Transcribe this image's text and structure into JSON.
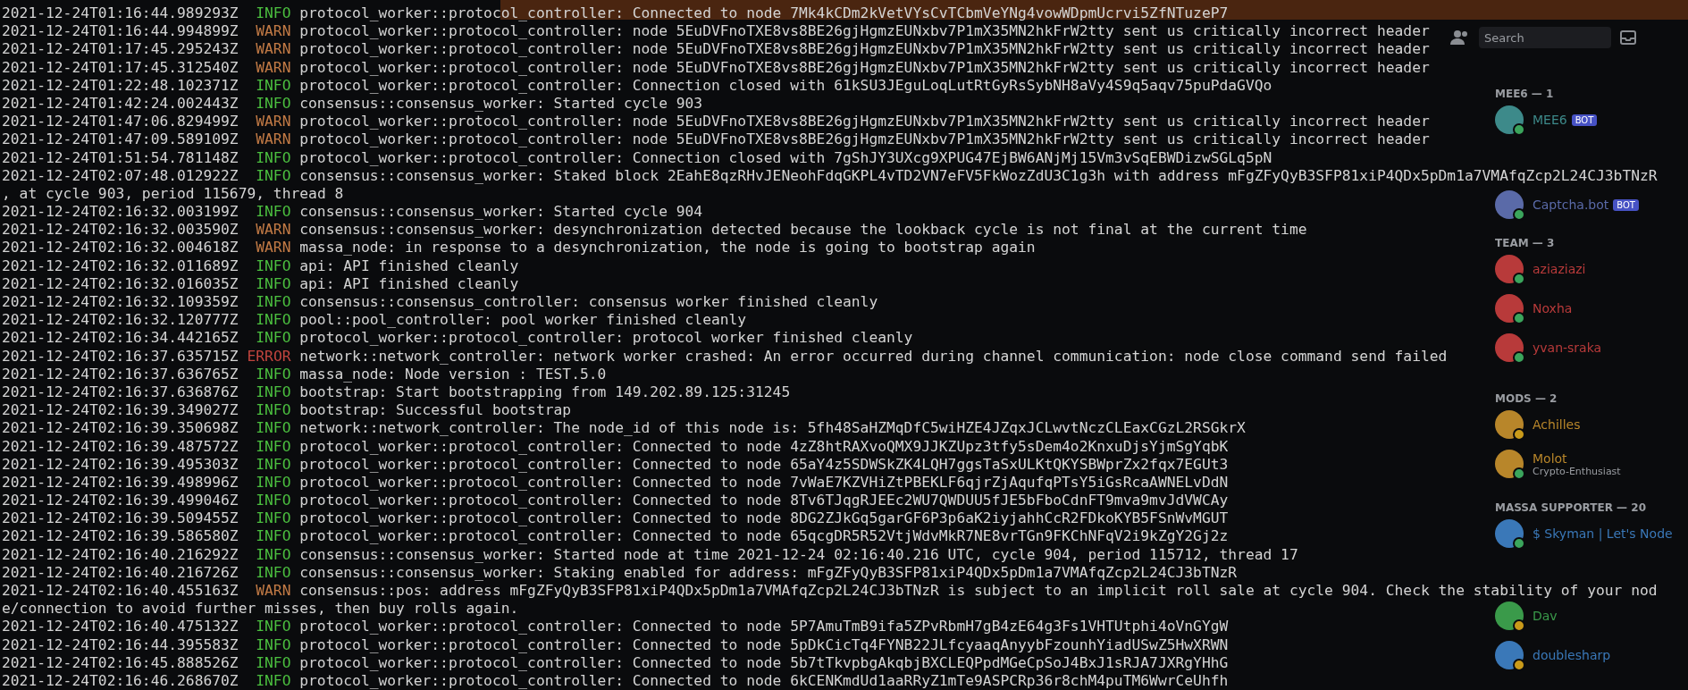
{
  "discord": {
    "search": {
      "placeholder": "Search"
    },
    "member_groups": [
      {
        "heading": "MEE6 — 1",
        "members": [
          {
            "name": "MEE6",
            "tag": "BOT",
            "color": "#3d8a8a",
            "idle": false
          }
        ]
      },
      {
        "members": [
          {
            "name": "Captcha.bot",
            "tag": "BOT",
            "color": "#5a6aa8",
            "idle": false
          }
        ]
      },
      {
        "heading": "TEAM — 3",
        "members": [
          {
            "name": "aziaziazi",
            "color": "#b83a3a",
            "idle": false
          },
          {
            "name": "Noxha",
            "color": "#b83a3a",
            "idle": false
          },
          {
            "name": "yvan-sraka",
            "color": "#b83a3a",
            "idle": false
          }
        ]
      },
      {
        "heading": "MODS — 2",
        "members": [
          {
            "name": "Achilles",
            "color": "#b8862a",
            "idle": true
          },
          {
            "name": "Molot",
            "subtitle": "Crypto-Enthusiast",
            "color": "#b8862a",
            "idle": false
          }
        ]
      },
      {
        "heading": "MASSA SUPPORTER — 20",
        "members": [
          {
            "name": "$ Skyman | Let's Node",
            "color": "#3a78b8",
            "idle": false
          },
          {
            "name": "Dav",
            "color": "#3a9a4a",
            "idle": true
          },
          {
            "name": "doublesharp",
            "color": "#3a78b8",
            "idle": true
          }
        ]
      }
    ]
  },
  "terminal": {
    "lines": [
      {
        "kind": "log",
        "timestamp": "2021-12-24T01:16:44.989293Z",
        "level": "INFO",
        "message": "protocol_worker::protocol_controller: Connected to node 7Mk4kCDm2kVetVYsCvTCbmVeYNg4vowWDpmUcrvi5ZfNTuzeP7"
      },
      {
        "kind": "log",
        "timestamp": "2021-12-24T01:16:44.994899Z",
        "level": "WARN",
        "message": "protocol_worker::protocol_controller: node 5EuDVFnoTXE8vs8BE26gjHgmzEUNxbv7P1mX35MN2hkFrW2tty sent us critically incorrect header"
      },
      {
        "kind": "log",
        "timestamp": "2021-12-24T01:17:45.295243Z",
        "level": "WARN",
        "message": "protocol_worker::protocol_controller: node 5EuDVFnoTXE8vs8BE26gjHgmzEUNxbv7P1mX35MN2hkFrW2tty sent us critically incorrect header"
      },
      {
        "kind": "log",
        "timestamp": "2021-12-24T01:17:45.312540Z",
        "level": "WARN",
        "message": "protocol_worker::protocol_controller: node 5EuDVFnoTXE8vs8BE26gjHgmzEUNxbv7P1mX35MN2hkFrW2tty sent us critically incorrect header"
      },
      {
        "kind": "log",
        "timestamp": "2021-12-24T01:22:48.102371Z",
        "level": "INFO",
        "message": "protocol_worker::protocol_controller: Connection closed with 61kSU3JEguLoqLutRtGyRsSybNH8aVy4S9q5aqv75puPdaGVQo"
      },
      {
        "kind": "log",
        "timestamp": "2021-12-24T01:42:24.002443Z",
        "level": "INFO",
        "message": "consensus::consensus_worker: Started cycle 903"
      },
      {
        "kind": "log",
        "timestamp": "2021-12-24T01:47:06.829499Z",
        "level": "WARN",
        "message": "protocol_worker::protocol_controller: node 5EuDVFnoTXE8vs8BE26gjHgmzEUNxbv7P1mX35MN2hkFrW2tty sent us critically incorrect header"
      },
      {
        "kind": "log",
        "timestamp": "2021-12-24T01:47:09.589109Z",
        "level": "WARN",
        "message": "protocol_worker::protocol_controller: node 5EuDVFnoTXE8vs8BE26gjHgmzEUNxbv7P1mX35MN2hkFrW2tty sent us critically incorrect header"
      },
      {
        "kind": "log",
        "timestamp": "2021-12-24T01:51:54.781148Z",
        "level": "INFO",
        "message": "protocol_worker::protocol_controller: Connection closed with 7gShJY3UXcg9XPUG47EjBW6ANjMj15Vm3vSqEBWDizwSGLq5pN"
      },
      {
        "kind": "log",
        "timestamp": "2021-12-24T02:07:48.012922Z",
        "level": "INFO",
        "message": "consensus::consensus_worker: Staked block 2EahE8qzRHvJENeohFdqGKPL4vTD2VN7eFV5FkWozZdU3C1g3h with address mFgZFyQyB3SFP81xiP4QDx5pDm1a7VMAfqZcp2L24CJ3bTNzR"
      },
      {
        "kind": "wrap",
        "message": ", at cycle 903, period 115679, thread 8"
      },
      {
        "kind": "log",
        "timestamp": "2021-12-24T02:16:32.003199Z",
        "level": "INFO",
        "message": "consensus::consensus_worker: Started cycle 904"
      },
      {
        "kind": "log",
        "timestamp": "2021-12-24T02:16:32.003590Z",
        "level": "WARN",
        "message": "consensus::consensus_worker: desynchronization detected because the lookback cycle is not final at the current time"
      },
      {
        "kind": "log",
        "timestamp": "2021-12-24T02:16:32.004618Z",
        "level": "WARN",
        "message": "massa_node: in response to a desynchronization, the node is going to bootstrap again"
      },
      {
        "kind": "log",
        "timestamp": "2021-12-24T02:16:32.011689Z",
        "level": "INFO",
        "message": "api: API finished cleanly"
      },
      {
        "kind": "log",
        "timestamp": "2021-12-24T02:16:32.016035Z",
        "level": "INFO",
        "message": "api: API finished cleanly"
      },
      {
        "kind": "log",
        "timestamp": "2021-12-24T02:16:32.109359Z",
        "level": "INFO",
        "message": "consensus::consensus_controller: consensus worker finished cleanly"
      },
      {
        "kind": "log",
        "timestamp": "2021-12-24T02:16:32.120777Z",
        "level": "INFO",
        "message": "pool::pool_controller: pool worker finished cleanly"
      },
      {
        "kind": "log",
        "timestamp": "2021-12-24T02:16:34.442165Z",
        "level": "INFO",
        "message": "protocol_worker::protocol_controller: protocol worker finished cleanly"
      },
      {
        "kind": "log",
        "timestamp": "2021-12-24T02:16:37.635715Z",
        "level": "ERROR",
        "message": "network::network_controller: network worker crashed: An error occurred during channel communication: node close command send failed"
      },
      {
        "kind": "log",
        "timestamp": "2021-12-24T02:16:37.636765Z",
        "level": "INFO",
        "message": "massa_node: Node version : TEST.5.0"
      },
      {
        "kind": "log",
        "timestamp": "2021-12-24T02:16:37.636876Z",
        "level": "INFO",
        "message": "bootstrap: Start bootstrapping from 149.202.89.125:31245"
      },
      {
        "kind": "log",
        "timestamp": "2021-12-24T02:16:39.349027Z",
        "level": "INFO",
        "message": "bootstrap: Successful bootstrap"
      },
      {
        "kind": "log",
        "timestamp": "2021-12-24T02:16:39.350698Z",
        "level": "INFO",
        "message": "network::network_controller: The node_id of this node is: 5fh48SaHZMqDfC5wiHZE4JZqxJCLwvtNczCLEaxCGzL2RSGkrX"
      },
      {
        "kind": "log",
        "timestamp": "2021-12-24T02:16:39.487572Z",
        "level": "INFO",
        "message": "protocol_worker::protocol_controller: Connected to node 4zZ8htRAXvoQMX9JJKZUpz3tfy5sDem4o2KnxuDjsYjmSgYqbK"
      },
      {
        "kind": "log",
        "timestamp": "2021-12-24T02:16:39.495303Z",
        "level": "INFO",
        "message": "protocol_worker::protocol_controller: Connected to node 65aY4z5SDWSkZK4LQH7ggsTaSxULKtQKYSBWprZx2fqx7EGUt3"
      },
      {
        "kind": "log",
        "timestamp": "2021-12-24T02:16:39.498996Z",
        "level": "INFO",
        "message": "protocol_worker::protocol_controller: Connected to node 7vWaE7KZVHiZtPBEKLF6qjrZjAqufqPTsY5iGsRcaAWNELvDdN"
      },
      {
        "kind": "log",
        "timestamp": "2021-12-24T02:16:39.499046Z",
        "level": "INFO",
        "message": "protocol_worker::protocol_controller: Connected to node 8Tv6TJqgRJEEc2WU7QWDUU5fJE5bFboCdnFT9mva9mvJdVWCAy"
      },
      {
        "kind": "log",
        "timestamp": "2021-12-24T02:16:39.509455Z",
        "level": "INFO",
        "message": "protocol_worker::protocol_controller: Connected to node 8DG2ZJkGq5garGF6P3p6aK2iyjahhCcR2FDkoKYB5FSnWvMGUT"
      },
      {
        "kind": "log",
        "timestamp": "2021-12-24T02:16:39.586580Z",
        "level": "INFO",
        "message": "protocol_worker::protocol_controller: Connected to node 65qcgDR5R52VtjWdvMkR7NE8vrTGn9FKChNFqV2i9kZgY2Gj2z"
      },
      {
        "kind": "log",
        "timestamp": "2021-12-24T02:16:40.216292Z",
        "level": "INFO",
        "message": "consensus::consensus_worker: Started node at time 2021-12-24 02:16:40.216 UTC, cycle 904, period 115712, thread 17"
      },
      {
        "kind": "log",
        "timestamp": "2021-12-24T02:16:40.216726Z",
        "level": "INFO",
        "message": "consensus::consensus_worker: Staking enabled for address: mFgZFyQyB3SFP81xiP4QDx5pDm1a7VMAfqZcp2L24CJ3bTNzR"
      },
      {
        "kind": "log",
        "timestamp": "2021-12-24T02:16:40.455163Z",
        "level": "WARN",
        "message": "consensus::pos: address mFgZFyQyB3SFP81xiP4QDx5pDm1a7VMAfqZcp2L24CJ3bTNzR is subject to an implicit roll sale at cycle 904. Check the stability of your nod"
      },
      {
        "kind": "wrap",
        "message": "e/connection to avoid further misses, then buy rolls again."
      },
      {
        "kind": "log",
        "timestamp": "2021-12-24T02:16:40.475132Z",
        "level": "INFO",
        "message": "protocol_worker::protocol_controller: Connected to node 5P7AmuTmB9ifa5ZPvRbmH7gB4zE64g3Fs1VHTUtphi4oVnGYgW"
      },
      {
        "kind": "log",
        "timestamp": "2021-12-24T02:16:44.395583Z",
        "level": "INFO",
        "message": "protocol_worker::protocol_controller: Connected to node 5pDkCicTq4FYNB22JLfcyaaqAnyybFzounhYiadUSwZ5HwXRWN"
      },
      {
        "kind": "log",
        "timestamp": "2021-12-24T02:16:45.888526Z",
        "level": "INFO",
        "message": "protocol_worker::protocol_controller: Connected to node 5b7tTkvpbgAkqbjBXCLEQPpdMGeCpSoJ4BxJ1sRJA7JXRgYHhG"
      },
      {
        "kind": "log",
        "timestamp": "2021-12-24T02:16:46.268670Z",
        "level": "INFO",
        "message": "protocol_worker::protocol_controller: Connected to node 6kCENKmdUd1aaRRyZ1mTe9ASPCRp36r8chM4puTM6WwrCeUhfh"
      }
    ]
  }
}
